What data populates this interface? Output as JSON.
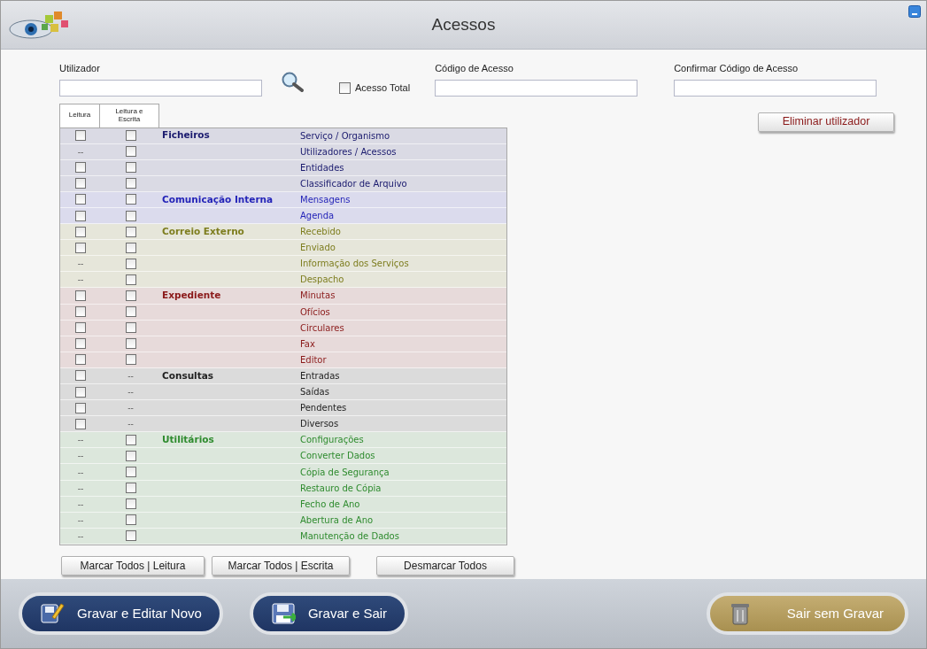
{
  "window": {
    "title": "Acessos"
  },
  "fields": {
    "user_label": "Utilizador",
    "full_access": {
      "label": "Acesso Total",
      "checked": false
    },
    "code_label": "Código de Acesso",
    "confirm_label": "Confirmar Código de Acesso"
  },
  "delete_button": "Eliminar utilizador",
  "table": {
    "columns": [
      "Leitura",
      "Leitura e Escrita"
    ],
    "groups": [
      {
        "name": "Ficheiros",
        "color": "#1a1a6e",
        "items": [
          {
            "label": "Serviço / Organismo",
            "read": {
              "kind": "checkbox",
              "checked": false
            },
            "write": {
              "kind": "checkbox",
              "checked": false
            }
          },
          {
            "label": "Utilizadores / Acessos",
            "read": {
              "kind": "dash",
              "text": "--"
            },
            "write": {
              "kind": "checkbox",
              "checked": false
            }
          },
          {
            "label": "Entidades",
            "read": {
              "kind": "checkbox",
              "checked": false
            },
            "write": {
              "kind": "checkbox",
              "checked": false
            }
          },
          {
            "label": "Classificador de Arquivo",
            "read": {
              "kind": "checkbox",
              "checked": false
            },
            "write": {
              "kind": "checkbox",
              "checked": false
            }
          }
        ]
      },
      {
        "name": "Comunicação Interna",
        "color": "#2424b8",
        "items": [
          {
            "label": "Mensagens",
            "read": {
              "kind": "checkbox",
              "checked": false
            },
            "write": {
              "kind": "checkbox",
              "checked": false
            }
          },
          {
            "label": "Agenda",
            "read": {
              "kind": "checkbox",
              "checked": false
            },
            "write": {
              "kind": "checkbox",
              "checked": false
            }
          }
        ]
      },
      {
        "name": "Correio Externo",
        "color": "#7d7d1e",
        "items": [
          {
            "label": "Recebido",
            "read": {
              "kind": "checkbox",
              "checked": false
            },
            "write": {
              "kind": "checkbox",
              "checked": false
            }
          },
          {
            "label": "Enviado",
            "read": {
              "kind": "checkbox",
              "checked": false
            },
            "write": {
              "kind": "checkbox",
              "checked": false
            }
          },
          {
            "label": "Informação dos Serviços",
            "read": {
              "kind": "dash",
              "text": "--"
            },
            "write": {
              "kind": "checkbox",
              "checked": false
            }
          },
          {
            "label": "Despacho",
            "read": {
              "kind": "dash",
              "text": "--"
            },
            "write": {
              "kind": "checkbox",
              "checked": false
            }
          }
        ]
      },
      {
        "name": "Expediente",
        "color": "#8b1a1a",
        "items": [
          {
            "label": "Minutas",
            "read": {
              "kind": "checkbox",
              "checked": false
            },
            "write": {
              "kind": "checkbox",
              "checked": false
            }
          },
          {
            "label": "Ofícios",
            "read": {
              "kind": "checkbox",
              "checked": false
            },
            "write": {
              "kind": "checkbox",
              "checked": false
            }
          },
          {
            "label": "Circulares",
            "read": {
              "kind": "checkbox",
              "checked": false
            },
            "write": {
              "kind": "checkbox",
              "checked": false
            }
          },
          {
            "label": "Fax",
            "read": {
              "kind": "checkbox",
              "checked": false
            },
            "write": {
              "kind": "checkbox",
              "checked": false
            }
          },
          {
            "label": "Editor",
            "read": {
              "kind": "checkbox",
              "checked": false
            },
            "write": {
              "kind": "checkbox",
              "checked": false
            }
          }
        ]
      },
      {
        "name": "Consultas",
        "color": "#222222",
        "items": [
          {
            "label": "Entradas",
            "read": {
              "kind": "checkbox",
              "checked": false
            },
            "write": {
              "kind": "dash",
              "text": "--"
            }
          },
          {
            "label": "Saídas",
            "read": {
              "kind": "checkbox",
              "checked": false
            },
            "write": {
              "kind": "dash",
              "text": "--"
            }
          },
          {
            "label": "Pendentes",
            "read": {
              "kind": "checkbox",
              "checked": false
            },
            "write": {
              "kind": "dash",
              "text": "--"
            }
          },
          {
            "label": "Diversos",
            "read": {
              "kind": "checkbox",
              "checked": false
            },
            "write": {
              "kind": "dash",
              "text": "--"
            }
          }
        ]
      },
      {
        "name": "Utilitários",
        "color": "#2e8b2e",
        "items": [
          {
            "label": "Configurações",
            "read": {
              "kind": "dash",
              "text": "--"
            },
            "write": {
              "kind": "checkbox",
              "checked": false
            }
          },
          {
            "label": "Converter Dados",
            "read": {
              "kind": "dash",
              "text": "--"
            },
            "write": {
              "kind": "checkbox",
              "checked": false
            }
          },
          {
            "label": "Cópia de Segurança",
            "read": {
              "kind": "dash",
              "text": "--"
            },
            "write": {
              "kind": "checkbox",
              "checked": false
            }
          },
          {
            "label": "Restauro de Cópia",
            "read": {
              "kind": "dash",
              "text": "--"
            },
            "write": {
              "kind": "checkbox",
              "checked": false
            }
          },
          {
            "label": "Fecho de Ano",
            "read": {
              "kind": "dash",
              "text": "--"
            },
            "write": {
              "kind": "checkbox",
              "checked": false
            }
          },
          {
            "label": "Abertura de Ano",
            "read": {
              "kind": "dash",
              "text": "--"
            },
            "write": {
              "kind": "checkbox",
              "checked": false
            }
          },
          {
            "label": "Manutenção de Dados",
            "read": {
              "kind": "dash",
              "text": "--"
            },
            "write": {
              "kind": "checkbox",
              "checked": false
            }
          }
        ]
      }
    ]
  },
  "table_buttons": [
    "Marcar Todos | Leitura",
    "Marcar Todos | Escrita",
    "Desmarcar Todos"
  ],
  "footer_buttons": [
    {
      "label": "Gravar e Editar Novo",
      "kind": "edit"
    },
    {
      "label": "Gravar e Sair",
      "kind": "save"
    },
    {
      "label": "Sair sem Gravar",
      "kind": "exit"
    }
  ]
}
